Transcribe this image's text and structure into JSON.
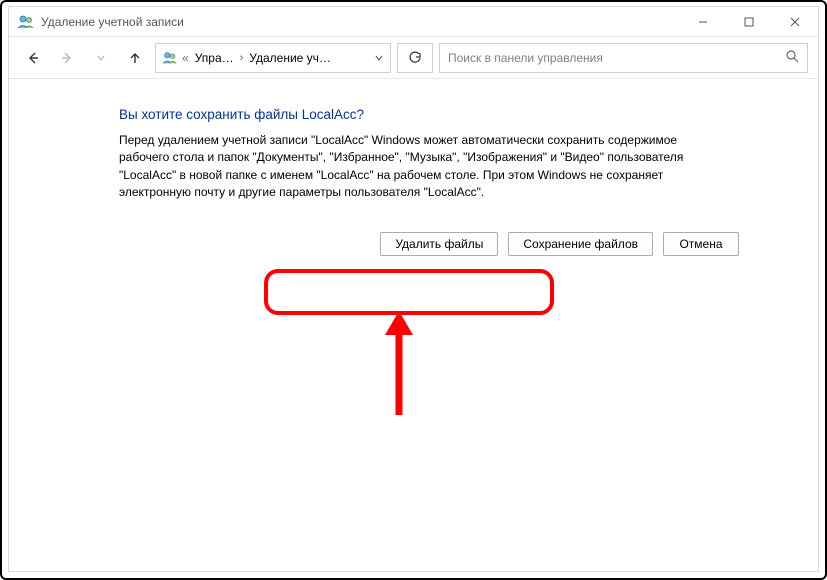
{
  "window": {
    "title": "Удаление учетной записи"
  },
  "breadcrumb": {
    "seg1": "Упра…",
    "seg2": "Удаление уч…"
  },
  "search": {
    "placeholder": "Поиск в панели управления"
  },
  "main": {
    "heading": "Вы хотите сохранить файлы LocalAcc?",
    "body": "Перед удалением учетной записи \"LocalAcc\" Windows может автоматически сохранить содержимое рабочего стола и папок \"Документы\", \"Избранное\", \"Музыка\", \"Изображения\" и \"Видео\" пользователя \"LocalAcc\" в новой папке с именем \"LocalAcc\" на рабочем столе. При этом Windows не сохраняет электронную почту и другие параметры пользователя \"LocalAcc\"."
  },
  "buttons": {
    "delete": "Удалить файлы",
    "keep": "Сохранение файлов",
    "cancel": "Отмена"
  }
}
